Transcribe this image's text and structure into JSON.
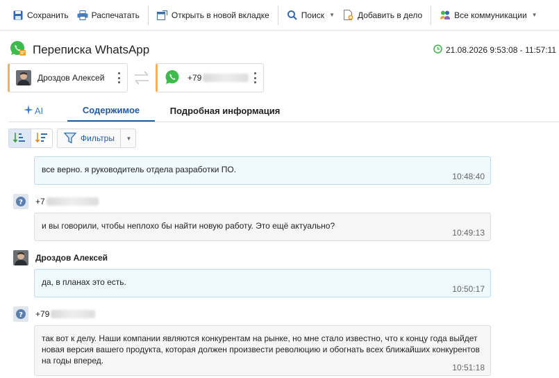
{
  "toolbar": {
    "save": "Сохранить",
    "print": "Распечатать",
    "open_new_tab": "Открыть в новой вкладке",
    "search": "Поиск",
    "add_to_case": "Добавить в дело",
    "all_communications": "Все коммуникации"
  },
  "title": {
    "text": "Переписка WhatsApp",
    "time_range": "21.08.2026 9:53:08 - 11:57:11"
  },
  "participants": [
    {
      "name": "Дроздов Алексей",
      "icon": "avatar"
    },
    {
      "name": "+79",
      "icon": "whatsapp-icon"
    }
  ],
  "tabs": [
    {
      "label": "AI"
    },
    {
      "label": "Содержимое",
      "active": true
    },
    {
      "label": "Подробная информация"
    }
  ],
  "filters": {
    "label": "Фильтры"
  },
  "messages": [
    {
      "direction": "out",
      "text": "все верно. я руководитель отдела разработки ПО.",
      "time": "10:48:40"
    },
    {
      "direction": "in",
      "sender": "+7",
      "text": "и вы говорили, чтобы неплохо бы найти новую работу. Это ещё актуально?",
      "time": "10:49:13"
    },
    {
      "direction": "out",
      "sender": "Дроздов Алексей",
      "text": "да, в планах это есть.",
      "time": "10:50:17"
    },
    {
      "direction": "in",
      "sender": "+79",
      "text": "так вот к делу. Наши компании являются конкурентам на рынке, но мне стало известно, что к концу года выйдет новая версия вашего продукта, которая должен произвести революцию и обогнать всех ближайших конкурентов на годы вперед.",
      "time": "10:51:18"
    }
  ],
  "colors": {
    "accent": "#1f5aa6",
    "card_border_left": "#f2b15a",
    "whatsapp": "#3dbb4c",
    "out_bubble": "#eef8fd",
    "in_bubble": "#f6f6f6"
  }
}
